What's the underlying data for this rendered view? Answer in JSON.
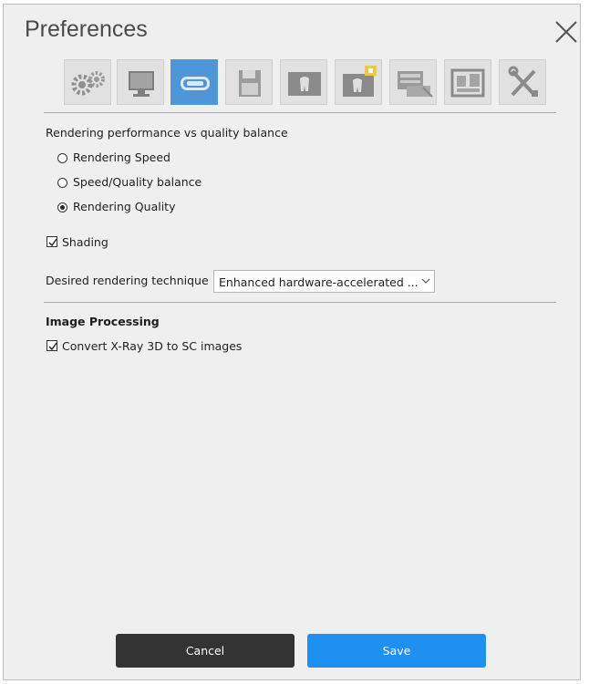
{
  "dialog": {
    "title": "Preferences"
  },
  "toolbar": {
    "buttons": [
      {
        "name": "general-settings-tab",
        "icon": "gears-icon",
        "active": false
      },
      {
        "name": "display-tab",
        "icon": "monitor-icon",
        "active": false
      },
      {
        "name": "3d-rendering-tab",
        "icon": "3d-icon",
        "active": true
      },
      {
        "name": "storage-tab",
        "icon": "floppy-disk-icon",
        "active": false
      },
      {
        "name": "panoramic-tab",
        "icon": "panoramic-tooth-icon",
        "active": false
      },
      {
        "name": "panoramic-special-tab",
        "icon": "panoramic-lock-icon",
        "active": false
      },
      {
        "name": "network-tab",
        "icon": "network-card-icon",
        "active": false
      },
      {
        "name": "images-tab",
        "icon": "image-gallery-icon",
        "active": false
      },
      {
        "name": "tools-tab",
        "icon": "tools-icon",
        "active": false
      }
    ]
  },
  "rendering": {
    "section_label": "Rendering performance vs quality balance",
    "options": [
      {
        "label": "Rendering Speed",
        "selected": false
      },
      {
        "label": "Speed/Quality balance",
        "selected": false
      },
      {
        "label": "Rendering Quality",
        "selected": true
      }
    ],
    "shading_label": "Shading",
    "shading_checked": true,
    "technique_label": "Desired rendering technique",
    "technique_value": "Enhanced hardware-accelerated ..."
  },
  "image_processing": {
    "heading": "Image Processing",
    "convert_label": "Convert X-Ray 3D to SC images",
    "convert_checked": true
  },
  "footer": {
    "cancel_label": "Cancel",
    "save_label": "Save"
  },
  "colors": {
    "accent": "#1f8ff0",
    "active_tab": "#4f96d8",
    "cancel_button": "#333333",
    "dialog_bg": "#efefef"
  }
}
